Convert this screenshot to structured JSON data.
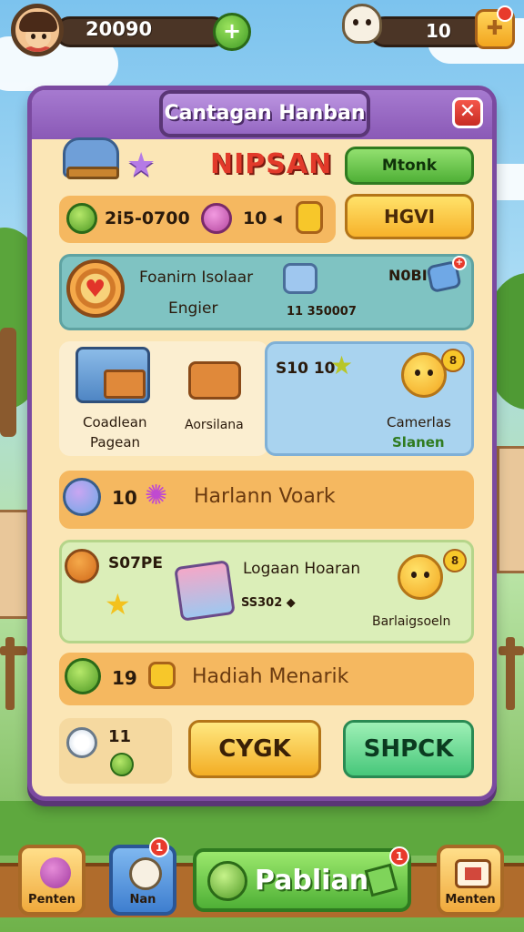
{
  "top_bar": {
    "coins": "20090",
    "gems": "10",
    "plus_label": "+"
  },
  "panel": {
    "title": "Cantagan Hanban",
    "close_label": "✕",
    "hero_title": "NIPSAN",
    "top_button": "Mtonk",
    "resource_row": {
      "value1": "2i5-0700",
      "value2": "10 ◂",
      "button": "HGVI"
    },
    "info_row": {
      "line1": "Foanirn Isolaar",
      "line2": "Engier",
      "value": "11 350007",
      "right_label": "N0BI"
    },
    "card_left": {
      "label1": "Coadlean",
      "label2": "Pagean",
      "label3": "Aorsilana"
    },
    "card_right": {
      "count": "S10 10",
      "label1": "Camerlas",
      "label2": "Slanen",
      "badge": "8"
    },
    "banner1": {
      "count": "10",
      "text": "Harlann Voark"
    },
    "reward_row": {
      "left_label": "S07PE",
      "title": "Logaan Hoaran",
      "value": "SS302 ◆",
      "right_label": "Barlaigsoeln",
      "badge": "8"
    },
    "banner2": {
      "count": "19",
      "text": "Hadiah Menarik"
    },
    "footer": {
      "count": "11",
      "btn1": "CYGK",
      "btn2": "SHPCK"
    }
  },
  "bottom_nav": {
    "tab1": "Penten",
    "tab2": "Nan",
    "tab2_badge": "1",
    "main": "Pablian",
    "main_badge": "1",
    "tab4": "Menten"
  },
  "colors": {
    "panel_border": "#7b4aa0",
    "panel_bg": "#fbe6b6",
    "accent_red": "#e23a2a",
    "button_green": "#4fb036",
    "button_yellow": "#f7b22a"
  }
}
